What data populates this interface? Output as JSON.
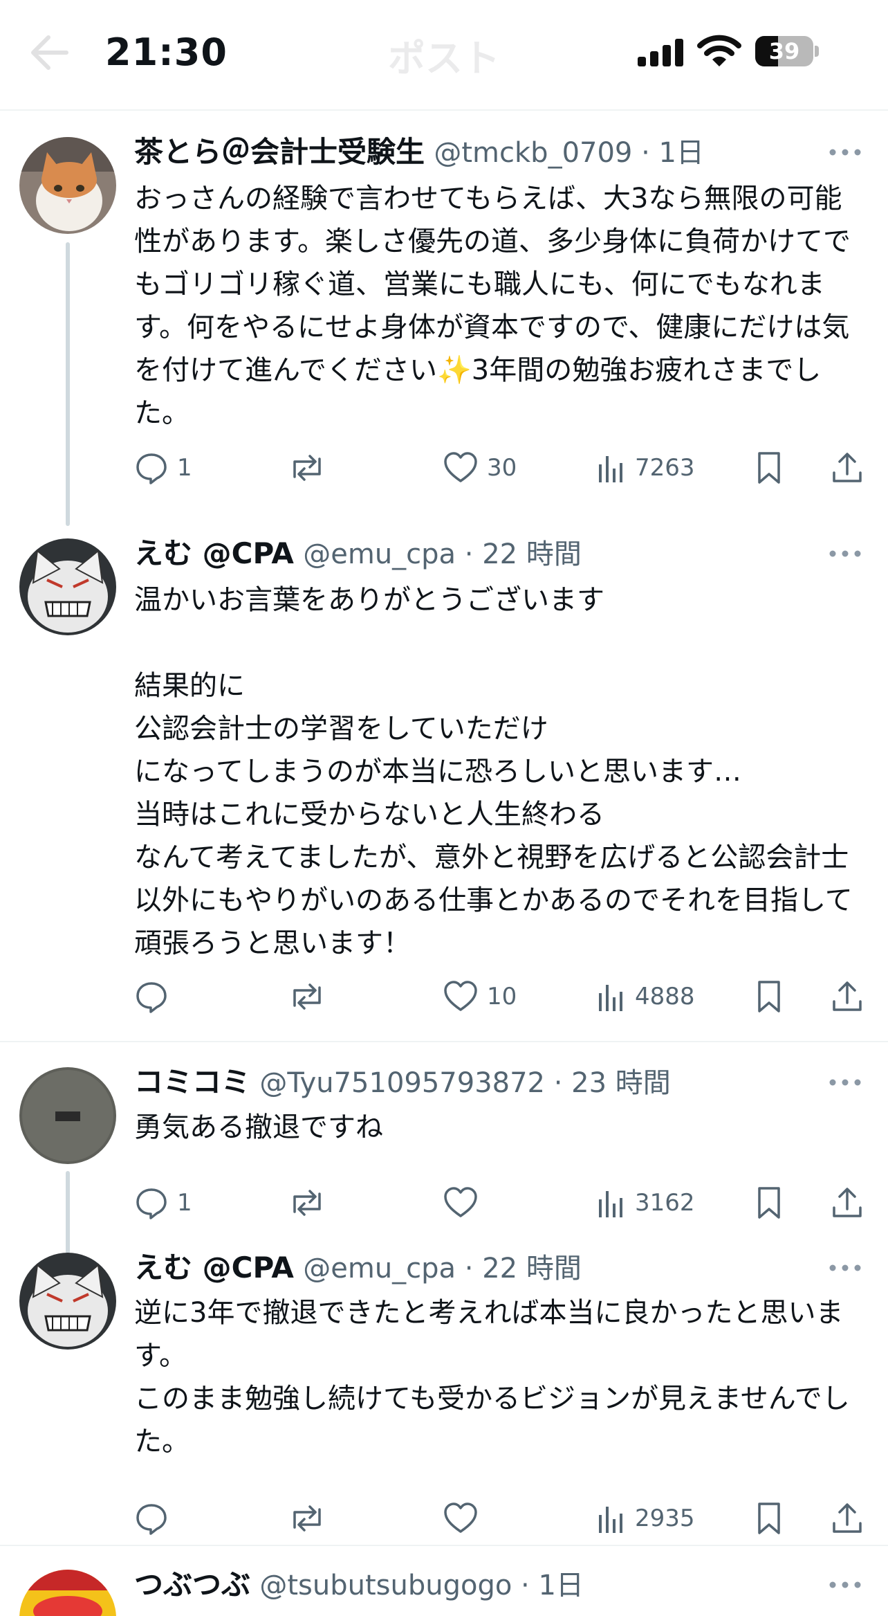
{
  "status_bar": {
    "time": "21:30",
    "battery": "39",
    "battery_level": 0.39
  },
  "header": {
    "title": "ポスト"
  },
  "tweets": [
    {
      "name": "茶とら＠会計士受験生",
      "handle": "@tmckb_0709",
      "time": "1日",
      "text": "おっさんの経験で言わせてもらえば、大3なら無限の可能性があります。楽しさ優先の道、多少身体に負荷かけてでもゴリゴリ稼ぐ道、営業にも職人にも、何にでもなれます。何をやるにせよ身体が資本ですので、健康にだけは気を付けて進んでください✨3年間の勉強お疲れさまでした。",
      "replies": "1",
      "likes": "30",
      "views": "7263"
    },
    {
      "name": "えむ @CPA",
      "handle": "@emu_cpa",
      "time": "22 時間",
      "text": "温かいお言葉をありがとうございます\n\n結果的に\n公認会計士の学習をしていただけ\nになってしまうのが本当に恐ろしいと思います…\n当時はこれに受からないと人生終わる\nなんて考えてましたが、意外と視野を広げると公認会計士以外にもやりがいのある仕事とかあるのでそれを目指して頑張ろうと思います！",
      "replies": "",
      "likes": "10",
      "views": "4888"
    },
    {
      "name": "コミコミ",
      "handle": "@Tyu751095793872",
      "time": "23 時間",
      "text": "勇気ある撤退ですね",
      "replies": "1",
      "likes": "",
      "views": "3162"
    },
    {
      "name": "えむ @CPA",
      "handle": "@emu_cpa",
      "time": "22 時間",
      "text": "逆に3年で撤退できたと考えれば本当に良かったと思います。\nこのまま勉強し続けても受かるビジョンが見えませんでした。",
      "replies": "",
      "likes": "",
      "views": "2935"
    },
    {
      "name": "つぶつぶ",
      "handle": "@tsubutsubugogo",
      "time": "1日"
    }
  ],
  "icons": {
    "reply": "speech-bubble-icon",
    "retweet": "repost-arrows-icon",
    "like": "heart-icon",
    "views": "bar-chart-icon",
    "bookmark": "bookmark-icon",
    "share": "share-upload-icon",
    "more": "ellipsis-icon"
  },
  "colors": {
    "text": "#0f1419",
    "secondary": "#536471",
    "divider": "#eff3f4",
    "thread": "#cfd9de"
  }
}
